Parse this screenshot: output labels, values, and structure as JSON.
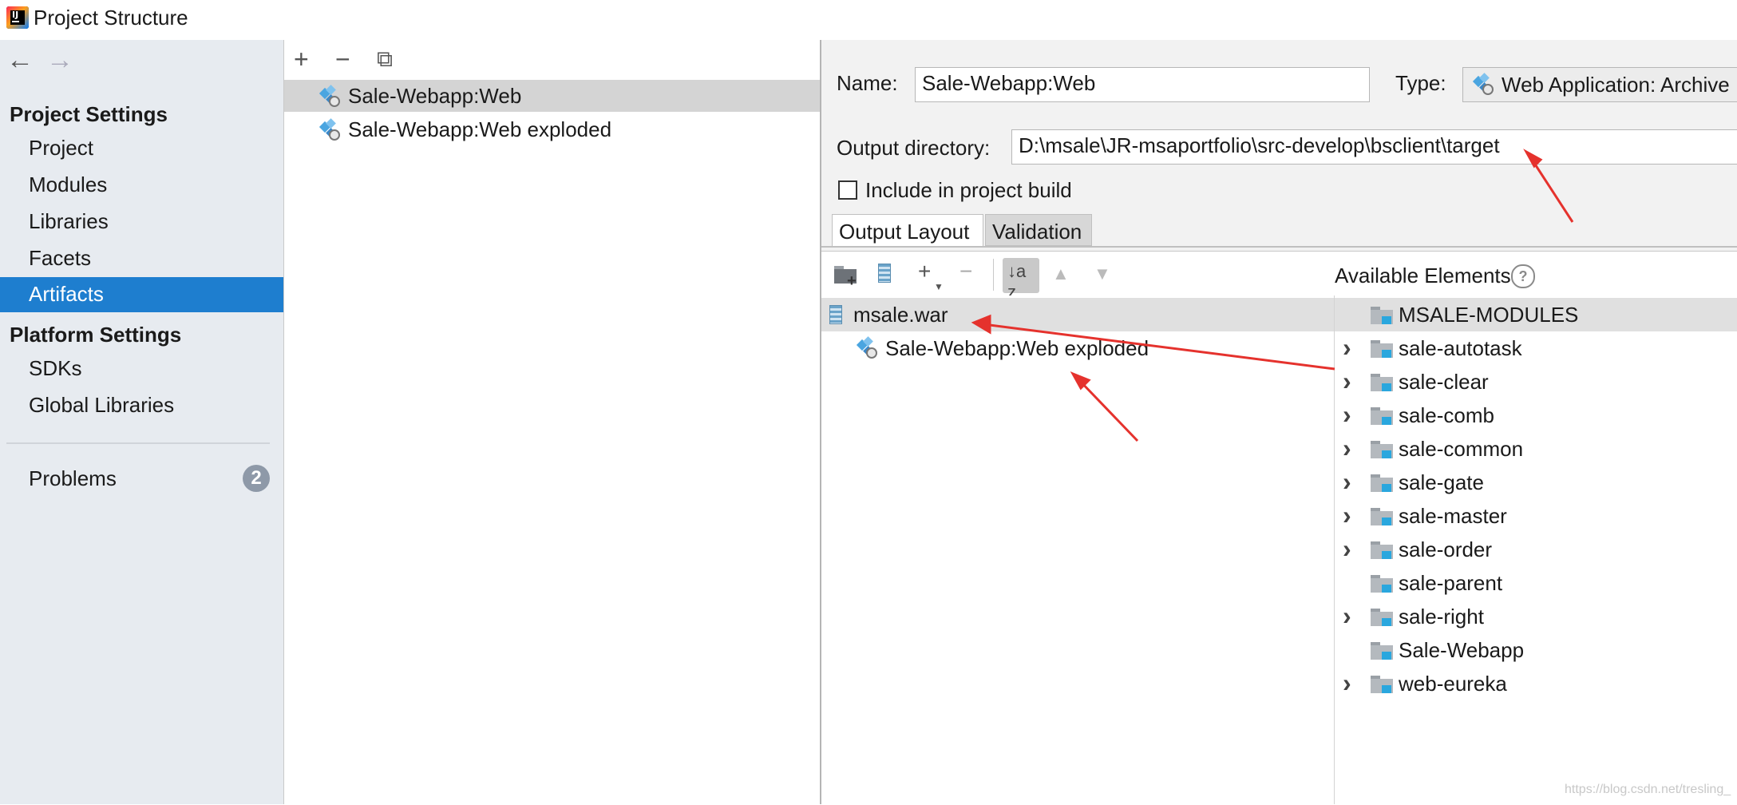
{
  "window": {
    "title": "Project Structure"
  },
  "nav": {
    "back_icon": "←",
    "forward_icon": "→",
    "project_settings_header": "Project Settings",
    "project_items": [
      "Project",
      "Modules",
      "Libraries",
      "Facets",
      "Artifacts"
    ],
    "selected": "Artifacts",
    "platform_settings_header": "Platform Settings",
    "platform_items": [
      "SDKs",
      "Global Libraries"
    ],
    "problems_label": "Problems",
    "problems_count": "2",
    "selected_color": "#1e7ecf"
  },
  "artifacts_toolbar": {
    "add": "+",
    "remove": "−",
    "copy": "⧉"
  },
  "artifacts": [
    {
      "label": "Sale-Webapp:Web",
      "selected": true
    },
    {
      "label": "Sale-Webapp:Web exploded",
      "selected": false
    }
  ],
  "detail": {
    "name_label": "Name:",
    "name_value": "Sale-Webapp:Web",
    "type_label": "Type:",
    "type_value": "Web Application: Archive",
    "output_dir_label": "Output directory:",
    "output_dir_value": "D:\\msale\\JR-msaportfolio\\src-develop\\bsclient\\target",
    "include_label": "Include in project build",
    "include_checked": false
  },
  "tabs": [
    {
      "label": "Output Layout",
      "active": true
    },
    {
      "label": "Validation",
      "active": false
    }
  ],
  "layout_toolbar": {
    "add": "+",
    "remove": "−",
    "sort": "↓a z",
    "up": "▲",
    "down": "▼"
  },
  "output_tree": [
    {
      "label": "msale.war",
      "level": 0,
      "icon": "archive-icon"
    },
    {
      "label": "Sale-Webapp:Web exploded",
      "level": 1,
      "icon": "artifact-icon"
    }
  ],
  "available": {
    "title": "Available Elements",
    "help": "?",
    "items": [
      {
        "label": "MSALE-MODULES",
        "expandable": false,
        "selected": true
      },
      {
        "label": "sale-autotask",
        "expandable": true
      },
      {
        "label": "sale-clear",
        "expandable": true
      },
      {
        "label": "sale-comb",
        "expandable": true
      },
      {
        "label": "sale-common",
        "expandable": true
      },
      {
        "label": "sale-gate",
        "expandable": true
      },
      {
        "label": "sale-master",
        "expandable": true
      },
      {
        "label": "sale-order",
        "expandable": true
      },
      {
        "label": "sale-parent",
        "expandable": false
      },
      {
        "label": "sale-right",
        "expandable": true
      },
      {
        "label": "Sale-Webapp",
        "expandable": false
      },
      {
        "label": "web-eureka",
        "expandable": true
      }
    ]
  },
  "annotation_color": "#e5322d",
  "watermark": "https://blog.csdn.net/tresling_"
}
